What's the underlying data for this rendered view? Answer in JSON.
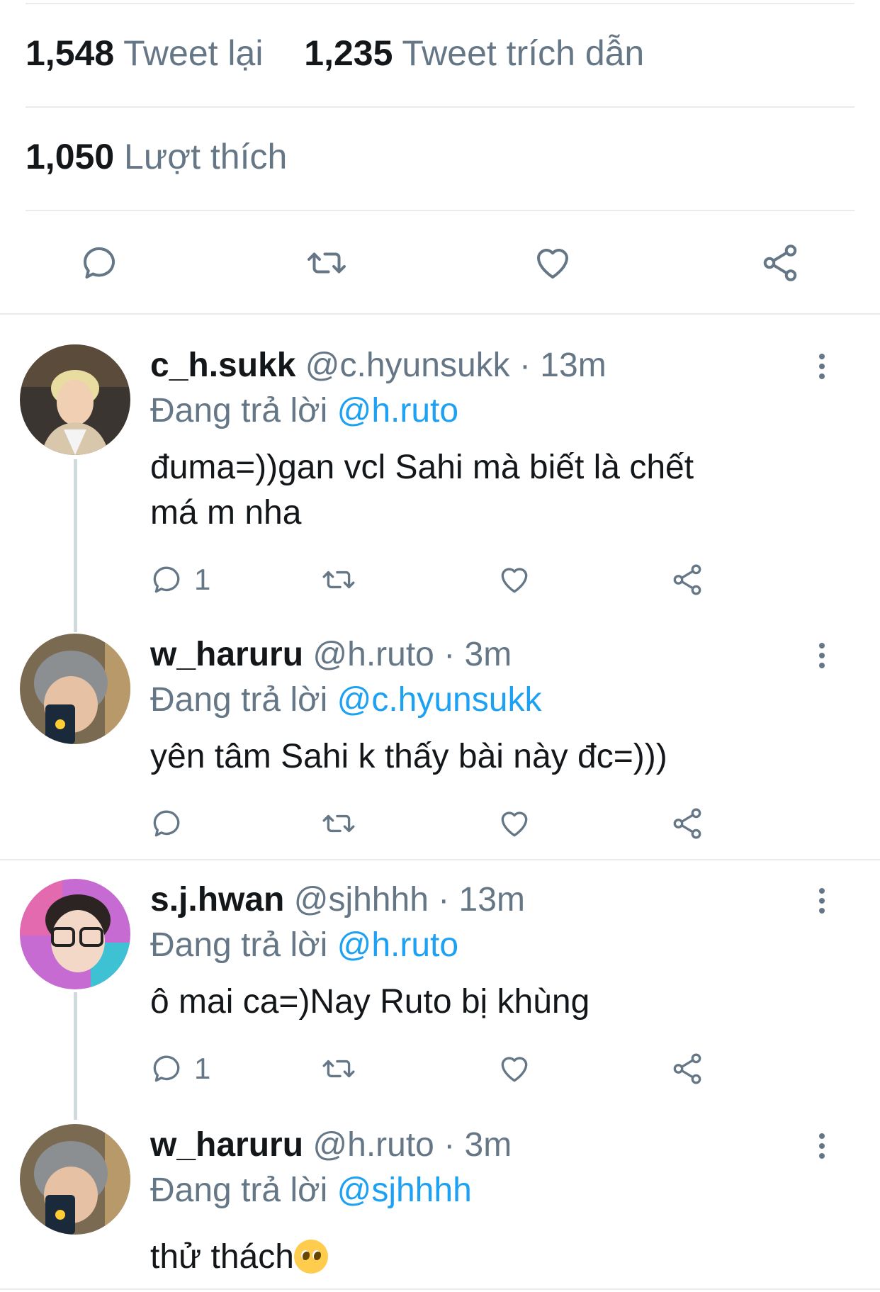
{
  "stats": {
    "retweets_count": "1,548",
    "retweets_label": "Tweet lại",
    "quotes_count": "1,235",
    "quotes_label": "Tweet trích dẫn",
    "likes_count": "1,050",
    "likes_label": "Lượt thích"
  },
  "main_actions": {
    "icons": [
      "reply-icon",
      "retweet-icon",
      "like-icon",
      "share-icon"
    ]
  },
  "replying_prefix": "Đang trả lời",
  "tweets": [
    {
      "name": "c_h.sukk",
      "meta": "@c.hyunsukk · 13m",
      "reply_handle": "@h.ruto",
      "text_line1": "đuma=))gan vcl Sahi mà biết là chết",
      "text_line2": "má m nha",
      "reply_count": "1"
    },
    {
      "name": "w_haruru",
      "meta": "@h.ruto · 3m",
      "reply_handle": "@c.hyunsukk",
      "text_line1": "yên tâm Sahi k thấy bài này đc=)))",
      "reply_count": ""
    },
    {
      "name": "s.j.hwan",
      "meta": "@sjhhhh · 13m",
      "reply_handle": "@h.ruto",
      "text_line1": "ô mai ca=)Nay Ruto bị khùng",
      "reply_count": "1"
    },
    {
      "name": "w_haruru",
      "meta": "@h.ruto · 3m",
      "reply_handle": "@sjhhhh",
      "text_line1": "thử thách",
      "emoji": "pleading-face-emoji"
    }
  ],
  "colors": {
    "link": "#1da1f2",
    "secondary": "#657786",
    "divider": "#e6ecf0"
  }
}
